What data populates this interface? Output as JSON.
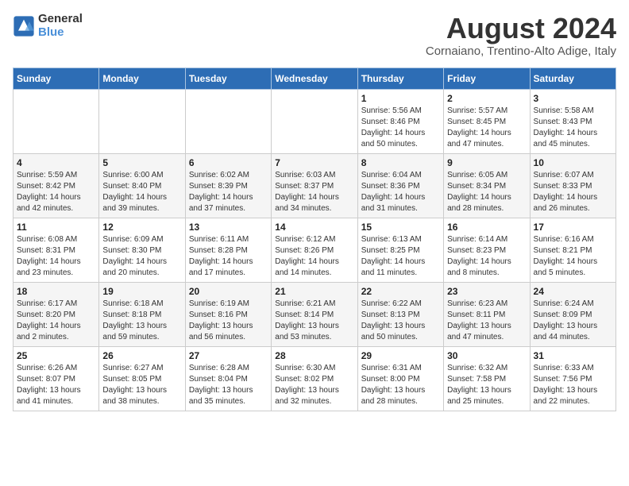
{
  "logo": {
    "line1": "General",
    "line2": "Blue"
  },
  "title": "August 2024",
  "subtitle": "Cornaiano, Trentino-Alto Adige, Italy",
  "days_of_week": [
    "Sunday",
    "Monday",
    "Tuesday",
    "Wednesday",
    "Thursday",
    "Friday",
    "Saturday"
  ],
  "weeks": [
    [
      {
        "day": "",
        "info": ""
      },
      {
        "day": "",
        "info": ""
      },
      {
        "day": "",
        "info": ""
      },
      {
        "day": "",
        "info": ""
      },
      {
        "day": "1",
        "info": "Sunrise: 5:56 AM\nSunset: 8:46 PM\nDaylight: 14 hours\nand 50 minutes."
      },
      {
        "day": "2",
        "info": "Sunrise: 5:57 AM\nSunset: 8:45 PM\nDaylight: 14 hours\nand 47 minutes."
      },
      {
        "day": "3",
        "info": "Sunrise: 5:58 AM\nSunset: 8:43 PM\nDaylight: 14 hours\nand 45 minutes."
      }
    ],
    [
      {
        "day": "4",
        "info": "Sunrise: 5:59 AM\nSunset: 8:42 PM\nDaylight: 14 hours\nand 42 minutes."
      },
      {
        "day": "5",
        "info": "Sunrise: 6:00 AM\nSunset: 8:40 PM\nDaylight: 14 hours\nand 39 minutes."
      },
      {
        "day": "6",
        "info": "Sunrise: 6:02 AM\nSunset: 8:39 PM\nDaylight: 14 hours\nand 37 minutes."
      },
      {
        "day": "7",
        "info": "Sunrise: 6:03 AM\nSunset: 8:37 PM\nDaylight: 14 hours\nand 34 minutes."
      },
      {
        "day": "8",
        "info": "Sunrise: 6:04 AM\nSunset: 8:36 PM\nDaylight: 14 hours\nand 31 minutes."
      },
      {
        "day": "9",
        "info": "Sunrise: 6:05 AM\nSunset: 8:34 PM\nDaylight: 14 hours\nand 28 minutes."
      },
      {
        "day": "10",
        "info": "Sunrise: 6:07 AM\nSunset: 8:33 PM\nDaylight: 14 hours\nand 26 minutes."
      }
    ],
    [
      {
        "day": "11",
        "info": "Sunrise: 6:08 AM\nSunset: 8:31 PM\nDaylight: 14 hours\nand 23 minutes."
      },
      {
        "day": "12",
        "info": "Sunrise: 6:09 AM\nSunset: 8:30 PM\nDaylight: 14 hours\nand 20 minutes."
      },
      {
        "day": "13",
        "info": "Sunrise: 6:11 AM\nSunset: 8:28 PM\nDaylight: 14 hours\nand 17 minutes."
      },
      {
        "day": "14",
        "info": "Sunrise: 6:12 AM\nSunset: 8:26 PM\nDaylight: 14 hours\nand 14 minutes."
      },
      {
        "day": "15",
        "info": "Sunrise: 6:13 AM\nSunset: 8:25 PM\nDaylight: 14 hours\nand 11 minutes."
      },
      {
        "day": "16",
        "info": "Sunrise: 6:14 AM\nSunset: 8:23 PM\nDaylight: 14 hours\nand 8 minutes."
      },
      {
        "day": "17",
        "info": "Sunrise: 6:16 AM\nSunset: 8:21 PM\nDaylight: 14 hours\nand 5 minutes."
      }
    ],
    [
      {
        "day": "18",
        "info": "Sunrise: 6:17 AM\nSunset: 8:20 PM\nDaylight: 14 hours\nand 2 minutes."
      },
      {
        "day": "19",
        "info": "Sunrise: 6:18 AM\nSunset: 8:18 PM\nDaylight: 13 hours\nand 59 minutes."
      },
      {
        "day": "20",
        "info": "Sunrise: 6:19 AM\nSunset: 8:16 PM\nDaylight: 13 hours\nand 56 minutes."
      },
      {
        "day": "21",
        "info": "Sunrise: 6:21 AM\nSunset: 8:14 PM\nDaylight: 13 hours\nand 53 minutes."
      },
      {
        "day": "22",
        "info": "Sunrise: 6:22 AM\nSunset: 8:13 PM\nDaylight: 13 hours\nand 50 minutes."
      },
      {
        "day": "23",
        "info": "Sunrise: 6:23 AM\nSunset: 8:11 PM\nDaylight: 13 hours\nand 47 minutes."
      },
      {
        "day": "24",
        "info": "Sunrise: 6:24 AM\nSunset: 8:09 PM\nDaylight: 13 hours\nand 44 minutes."
      }
    ],
    [
      {
        "day": "25",
        "info": "Sunrise: 6:26 AM\nSunset: 8:07 PM\nDaylight: 13 hours\nand 41 minutes."
      },
      {
        "day": "26",
        "info": "Sunrise: 6:27 AM\nSunset: 8:05 PM\nDaylight: 13 hours\nand 38 minutes."
      },
      {
        "day": "27",
        "info": "Sunrise: 6:28 AM\nSunset: 8:04 PM\nDaylight: 13 hours\nand 35 minutes."
      },
      {
        "day": "28",
        "info": "Sunrise: 6:30 AM\nSunset: 8:02 PM\nDaylight: 13 hours\nand 32 minutes."
      },
      {
        "day": "29",
        "info": "Sunrise: 6:31 AM\nSunset: 8:00 PM\nDaylight: 13 hours\nand 28 minutes."
      },
      {
        "day": "30",
        "info": "Sunrise: 6:32 AM\nSunset: 7:58 PM\nDaylight: 13 hours\nand 25 minutes."
      },
      {
        "day": "31",
        "info": "Sunrise: 6:33 AM\nSunset: 7:56 PM\nDaylight: 13 hours\nand 22 minutes."
      }
    ]
  ]
}
